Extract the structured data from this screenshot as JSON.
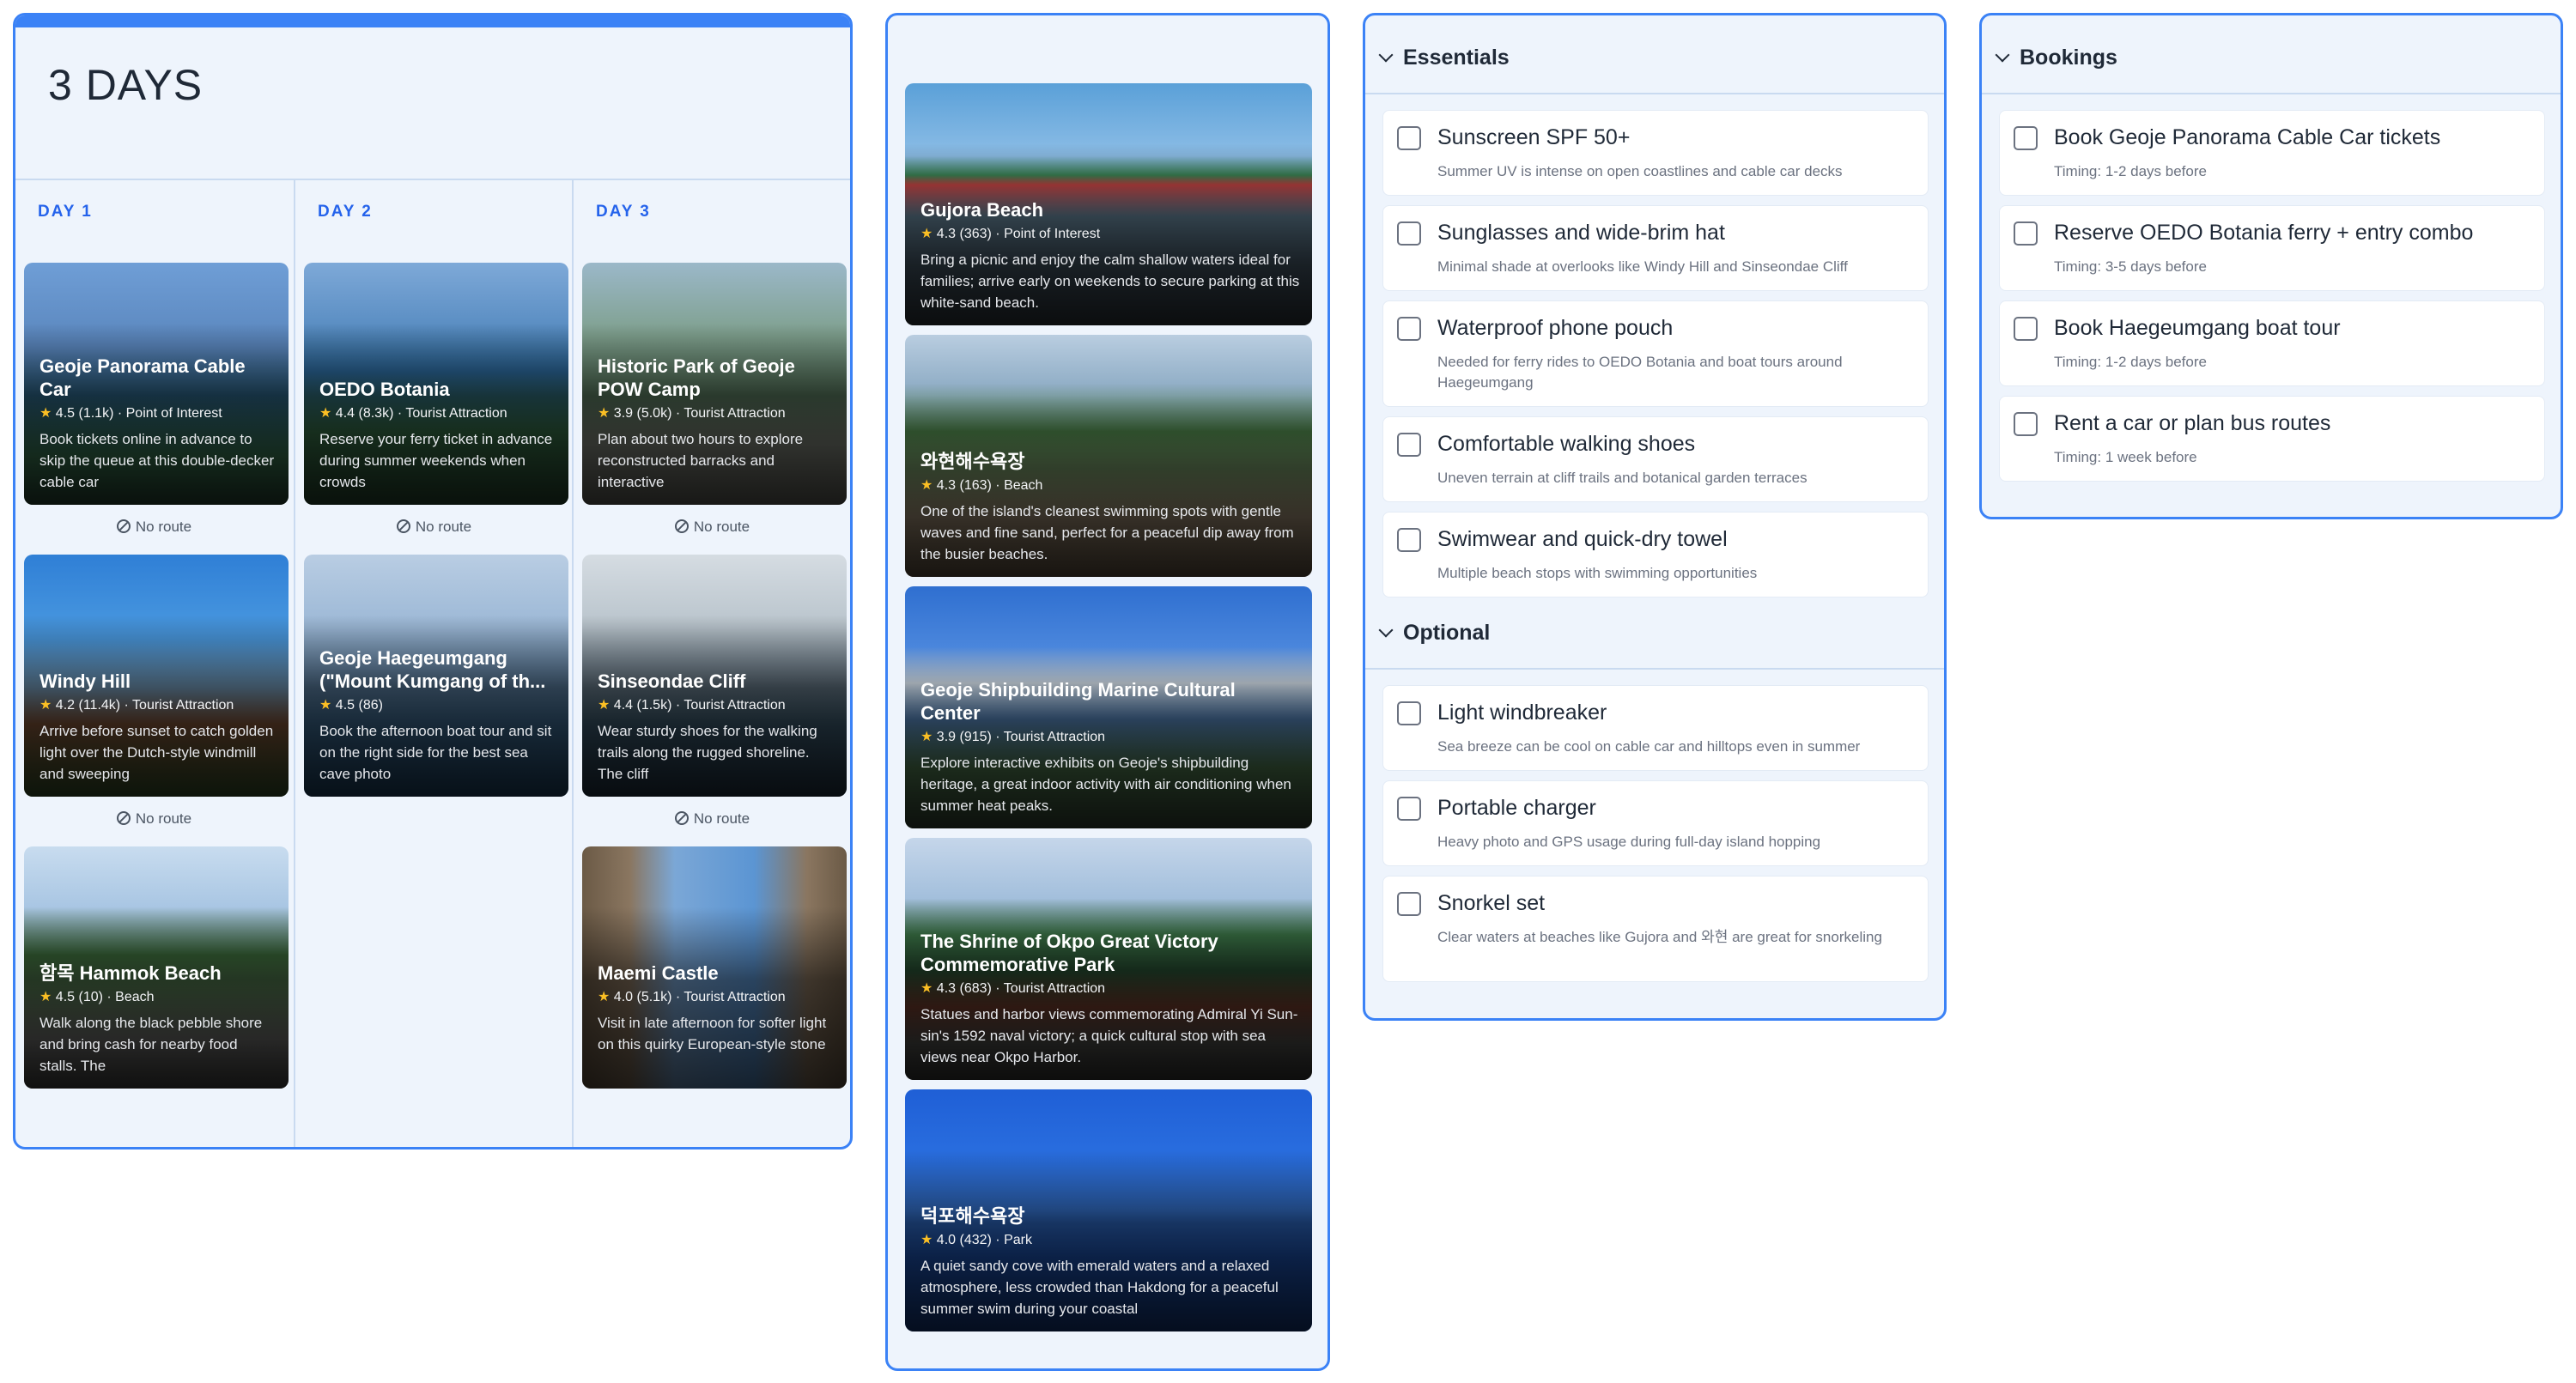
{
  "itinerary": {
    "title": "3 DAYS",
    "days": [
      {
        "label": "DAY 1",
        "places": [
          {
            "name": "Geoje Panorama Cable Car",
            "rating": "4.5",
            "reviews": "(1.1k)",
            "category": "Point of Interest",
            "desc": "Book tickets online in advance to skip the queue at this double-decker cable car",
            "route": "No route"
          },
          {
            "name": "Windy Hill",
            "rating": "4.2",
            "reviews": "(11.4k)",
            "category": "Tourist Attraction",
            "desc": "Arrive before sunset to catch golden light over the Dutch-style windmill and sweeping",
            "route": "No route"
          },
          {
            "name": "함목 Hammok Beach",
            "rating": "4.5",
            "reviews": "(10)",
            "category": "Beach",
            "desc": "Walk along the black pebble shore and bring cash for nearby food stalls. The",
            "route": ""
          }
        ]
      },
      {
        "label": "DAY 2",
        "places": [
          {
            "name": "OEDO Botania",
            "rating": "4.4",
            "reviews": "(8.3k)",
            "category": "Tourist Attraction",
            "desc": "Reserve your ferry ticket in advance during summer weekends when crowds",
            "route": "No route"
          },
          {
            "name": "Geoje Haegeumgang (\"Mount Kumgang of th...",
            "rating": "4.5",
            "reviews": "(86)",
            "category": "",
            "desc": "Book the afternoon boat tour and sit on the right side for the best sea cave photo",
            "route": ""
          }
        ]
      },
      {
        "label": "DAY 3",
        "places": [
          {
            "name": "Historic Park of Geoje POW Camp",
            "rating": "3.9",
            "reviews": "(5.0k)",
            "category": "Tourist Attraction",
            "desc": "Plan about two hours to explore reconstructed barracks and interactive",
            "route": "No route"
          },
          {
            "name": "Sinseondae Cliff",
            "rating": "4.4",
            "reviews": "(1.5k)",
            "category": "Tourist Attraction",
            "desc": "Wear sturdy shoes for the walking trails along the rugged shoreline. The cliff",
            "route": "No route"
          },
          {
            "name": "Maemi Castle",
            "rating": "4.0",
            "reviews": "(5.1k)",
            "category": "Tourist Attraction",
            "desc": "Visit in late afternoon for softer light on this quirky European-style stone",
            "route": ""
          }
        ]
      }
    ]
  },
  "suggestions": [
    {
      "name": "Gujora Beach",
      "rating": "4.3",
      "reviews": "(363)",
      "category": "Point of Interest",
      "desc": "Bring a picnic and enjoy the calm shallow waters ideal for families; arrive early on weekends to secure parking at this white-sand beach."
    },
    {
      "name": "와현해수욕장",
      "rating": "4.3",
      "reviews": "(163)",
      "category": "Beach",
      "desc": "One of the island's cleanest swimming spots with gentle waves and fine sand, perfect for a peaceful dip away from the busier beaches."
    },
    {
      "name": "Geoje Shipbuilding Marine Cultural Center",
      "rating": "3.9",
      "reviews": "(915)",
      "category": "Tourist Attraction",
      "desc": "Explore interactive exhibits on Geoje's shipbuilding heritage, a great indoor activity with air conditioning when summer heat peaks."
    },
    {
      "name": "The Shrine of Okpo Great Victory Commemorative Park",
      "rating": "4.3",
      "reviews": "(683)",
      "category": "Tourist Attraction",
      "desc": "Statues and harbor views commemorating Admiral Yi Sun-sin's 1592 naval victory; a quick cultural stop with sea views near Okpo Harbor."
    },
    {
      "name": "덕포해수욕장",
      "rating": "4.0",
      "reviews": "(432)",
      "category": "Park",
      "desc": "A quiet sandy cove with emerald waters and a relaxed atmosphere, less crowded than Hakdong for a peaceful summer swim during your coastal"
    }
  ],
  "essentials": {
    "title": "Essentials",
    "items": [
      {
        "title": "Sunscreen SPF 50+",
        "sub": "Summer UV is intense on open coastlines and cable car decks"
      },
      {
        "title": "Sunglasses and wide-brim hat",
        "sub": "Minimal shade at overlooks like Windy Hill and Sinseondae Cliff"
      },
      {
        "title": "Waterproof phone pouch",
        "sub": "Needed for ferry rides to OEDO Botania and boat tours around Haegeumgang"
      },
      {
        "title": "Comfortable walking shoes",
        "sub": "Uneven terrain at cliff trails and botanical garden terraces"
      },
      {
        "title": "Swimwear and quick-dry towel",
        "sub": "Multiple beach stops with swimming opportunities"
      }
    ]
  },
  "optional": {
    "title": "Optional",
    "items": [
      {
        "title": "Light windbreaker",
        "sub": "Sea breeze can be cool on cable car and hilltops even in summer"
      },
      {
        "title": "Portable charger",
        "sub": "Heavy photo and GPS usage during full-day island hopping"
      },
      {
        "title": "Snorkel set",
        "sub": "Clear waters at beaches like Gujora and 와현 are great for snorkeling"
      }
    ]
  },
  "bookings": {
    "title": "Bookings",
    "items": [
      {
        "title": "Book Geoje Panorama Cable Car tickets",
        "sub": "Timing: 1-2 days before"
      },
      {
        "title": "Reserve OEDO Botania ferry + entry combo",
        "sub": "Timing: 3-5 days before"
      },
      {
        "title": "Book Haegeumgang boat tour",
        "sub": "Timing: 1-2 days before"
      },
      {
        "title": "Rent a car or plan bus routes",
        "sub": "Timing: 1 week before"
      }
    ]
  },
  "colors": {
    "accent": "#3b82f6",
    "day_label": "#2563eb",
    "panel_bg": "#eef4fc",
    "star": "#fbbf24"
  }
}
